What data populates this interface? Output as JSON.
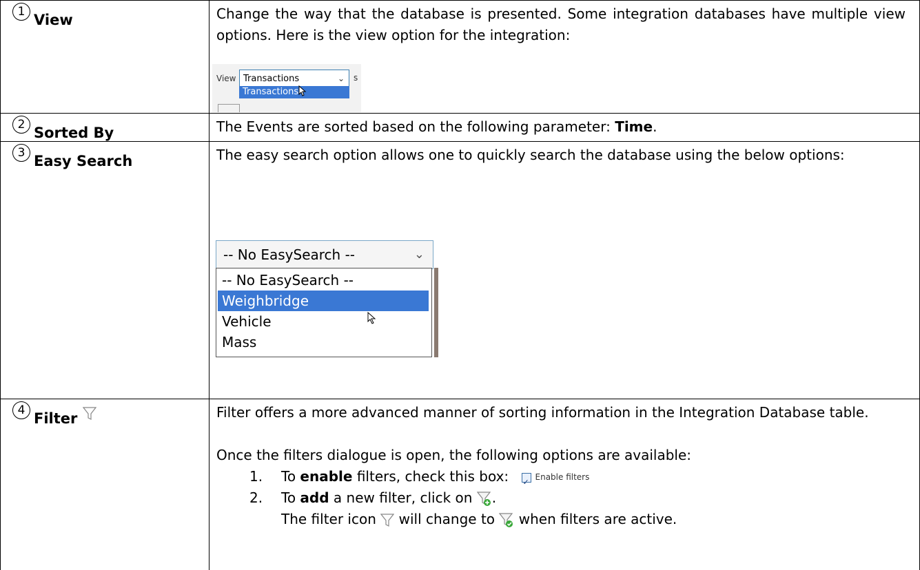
{
  "rows": [
    {
      "num": "1",
      "label": "View",
      "text": "Change the way that the database is presented. Some integration databases have multiple view options. Here is the view option for the integration:",
      "snapshot": {
        "view_label": "View",
        "selected": "Transactions",
        "option_highlight": "Transactions",
        "fragment": "s"
      }
    },
    {
      "num": "2",
      "label": "Sorted By",
      "text_prefix": "The Events are sorted based on the following parameter: ",
      "text_bold": "Time",
      "text_suffix": "."
    },
    {
      "num": "3",
      "label": "Easy Search",
      "text": "The easy search option allows one to quickly search the database using the below options:",
      "snapshot": {
        "selected": "-- No EasySearch --",
        "options": [
          "-- No EasySearch --",
          "Weighbridge",
          "Vehicle",
          "Mass"
        ],
        "highlighted_index": 1
      }
    },
    {
      "num": "4",
      "label": "Filter",
      "text1": "Filter offers a more advanced manner of sorting information in the Integration Database table.",
      "text2": "Once the filters dialogue is open, the following options are available:",
      "item1_num": "1.",
      "item1_pre": "To ",
      "item1_bold": "enable",
      "item1_post": " filters, check this box: ",
      "item1_checkbox_label": "Enable filters",
      "item2_num": "2.",
      "item2_pre": "To ",
      "item2_bold": "add",
      "item2_post": " a new filter, click on ",
      "item2_end": ".",
      "item3_pre": "The filter icon ",
      "item3_mid": " will change to ",
      "item3_post": " when filters are active."
    }
  ],
  "colors": {
    "highlight": "#3a78d4",
    "border": "#000000"
  },
  "icons": [
    "filter-icon",
    "filter-add-icon",
    "filter-active-icon",
    "checkbox-icon",
    "chevron-down-icon",
    "cursor-icon"
  ]
}
